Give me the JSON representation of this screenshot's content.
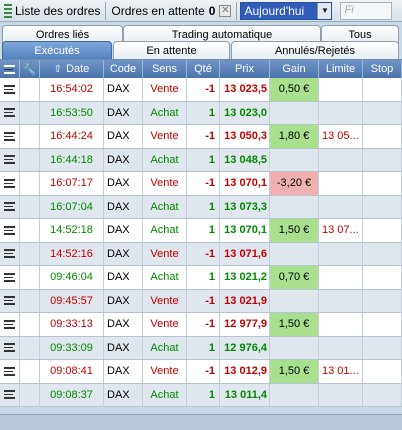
{
  "toolbar": {
    "orders_list_label": "Liste des ordres",
    "pending_label": "Ordres en attente",
    "pending_count": "0",
    "period_value": "Aujourd'hui",
    "filter_placeholder": "Fi"
  },
  "tabs": {
    "linked": "Ordres liés",
    "auto": "Trading automatique",
    "all": "Tous",
    "executed": "Exécutés",
    "pending": "En attente",
    "cancelled": "Annulés/Rejetés"
  },
  "columns": {
    "date": "Date",
    "code": "Code",
    "sens": "Sens",
    "qty": "Qté",
    "price": "Prix",
    "gain": "Gain",
    "limit": "Limite",
    "stop": "Stop"
  },
  "rows": [
    {
      "time": "16:54:02",
      "code": "DAX",
      "sens": "Vente",
      "qty": "-1",
      "price": "13 023,5",
      "gain": "0,50 €",
      "limit": "",
      "stop": ""
    },
    {
      "time": "16:53:50",
      "code": "DAX",
      "sens": "Achat",
      "qty": "1",
      "price": "13 023,0",
      "gain": "",
      "limit": "",
      "stop": ""
    },
    {
      "time": "16:44:24",
      "code": "DAX",
      "sens": "Vente",
      "qty": "-1",
      "price": "13 050,3",
      "gain": "1,80 €",
      "limit": "13 05...",
      "stop": ""
    },
    {
      "time": "16:44:18",
      "code": "DAX",
      "sens": "Achat",
      "qty": "1",
      "price": "13 048,5",
      "gain": "",
      "limit": "",
      "stop": ""
    },
    {
      "time": "16:07:17",
      "code": "DAX",
      "sens": "Vente",
      "qty": "-1",
      "price": "13 070,1",
      "gain": "-3,20 €",
      "limit": "",
      "stop": ""
    },
    {
      "time": "16:07:04",
      "code": "DAX",
      "sens": "Achat",
      "qty": "1",
      "price": "13 073,3",
      "gain": "",
      "limit": "",
      "stop": ""
    },
    {
      "time": "14:52:18",
      "code": "DAX",
      "sens": "Achat",
      "qty": "1",
      "price": "13 070,1",
      "gain": "1,50 €",
      "limit": "13 07...",
      "stop": ""
    },
    {
      "time": "14:52:16",
      "code": "DAX",
      "sens": "Vente",
      "qty": "-1",
      "price": "13 071,6",
      "gain": "",
      "limit": "",
      "stop": ""
    },
    {
      "time": "09:46:04",
      "code": "DAX",
      "sens": "Achat",
      "qty": "1",
      "price": "13 021,2",
      "gain": "0,70 €",
      "limit": "",
      "stop": ""
    },
    {
      "time": "09:45:57",
      "code": "DAX",
      "sens": "Vente",
      "qty": "-1",
      "price": "13 021,9",
      "gain": "",
      "limit": "",
      "stop": ""
    },
    {
      "time": "09:33:13",
      "code": "DAX",
      "sens": "Vente",
      "qty": "-1",
      "price": "12 977,9",
      "gain": "1,50 €",
      "limit": "",
      "stop": ""
    },
    {
      "time": "09:33:09",
      "code": "DAX",
      "sens": "Achat",
      "qty": "1",
      "price": "12 976,4",
      "gain": "",
      "limit": "",
      "stop": ""
    },
    {
      "time": "09:08:41",
      "code": "DAX",
      "sens": "Vente",
      "qty": "-1",
      "price": "13 012,9",
      "gain": "1,50 €",
      "limit": "13 01...",
      "stop": ""
    },
    {
      "time": "09:08:37",
      "code": "DAX",
      "sens": "Achat",
      "qty": "1",
      "price": "13 011,4",
      "gain": "",
      "limit": "",
      "stop": ""
    }
  ],
  "colors": {
    "sell": "#c00000",
    "buy": "#008a00",
    "gain_positive": "#a8e08e",
    "gain_negative": "#f0b0b0",
    "header": "#4a73ad"
  }
}
